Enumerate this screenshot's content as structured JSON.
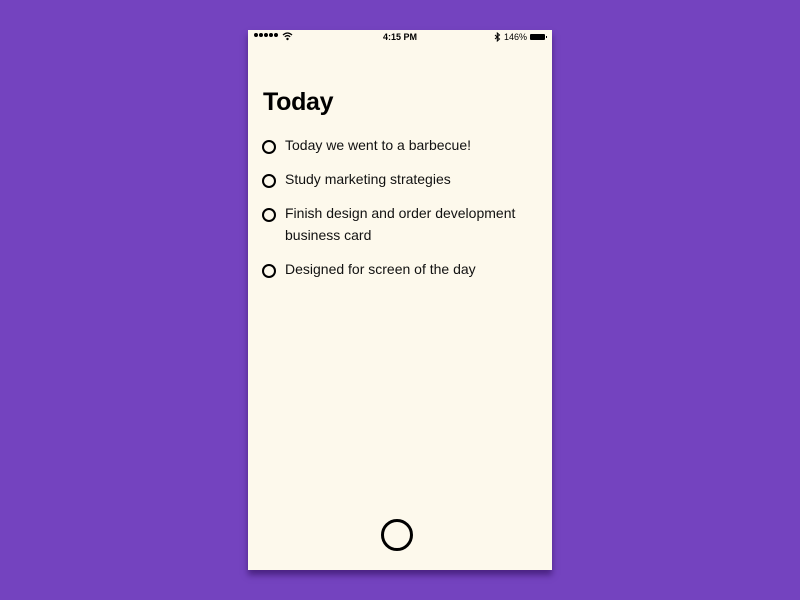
{
  "status_bar": {
    "time": "4:15 PM",
    "battery_percent": "146%",
    "icons": [
      "signal-dots-icon",
      "wifi-icon",
      "bluetooth-icon",
      "battery-icon"
    ]
  },
  "header": {
    "title": "Today"
  },
  "tasks": [
    {
      "text": "Today we went to a barbecue!",
      "done": false
    },
    {
      "text": "Study marketing strategies",
      "done": false
    },
    {
      "text": "Finish design and order development business card",
      "done": false
    },
    {
      "text": "Designed for screen of the day",
      "done": false
    }
  ],
  "colors": {
    "background": "#7443bf",
    "screen": "#fdf9ec",
    "text": "#000000"
  }
}
